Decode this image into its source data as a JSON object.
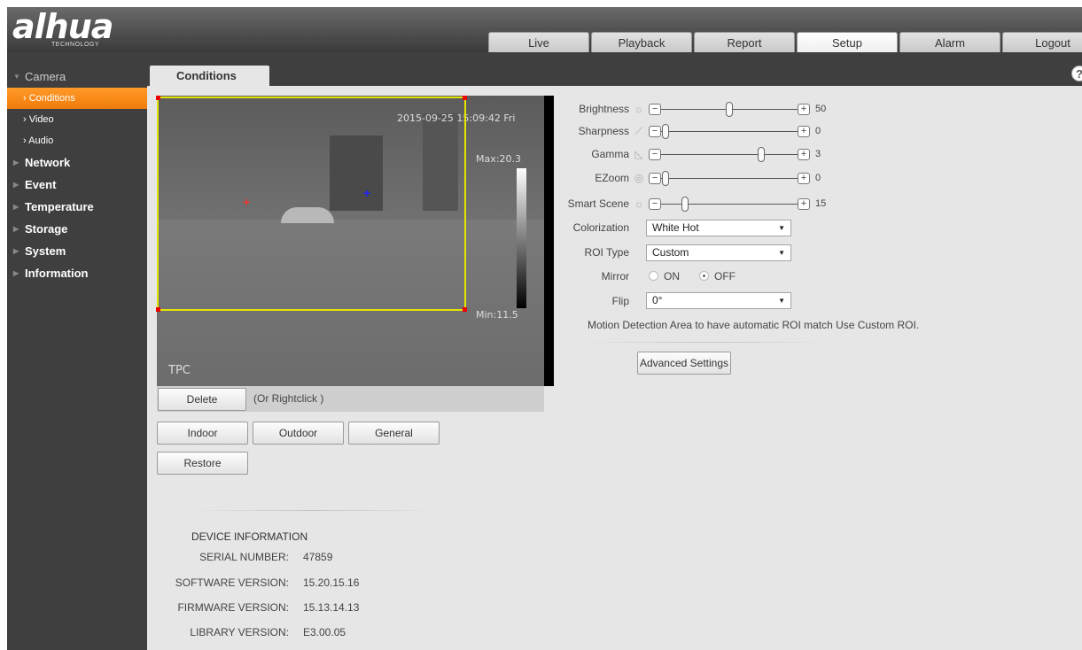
{
  "header": {
    "logo": "alhua",
    "logo_sub": "TECHNOLOGY",
    "tabs": [
      "Live",
      "Playback",
      "Report",
      "Setup",
      "Alarm",
      "Logout"
    ],
    "active_tab": "Setup"
  },
  "sidebar": {
    "camera": "Camera",
    "camera_items": [
      "Conditions",
      "Video",
      "Audio"
    ],
    "active_item": "Conditions",
    "sections": [
      "Network",
      "Event",
      "Temperature",
      "Storage",
      "System",
      "Information"
    ]
  },
  "page": {
    "tab": "Conditions",
    "help": "?"
  },
  "video": {
    "timestamp": "2015-09-25 15:09:42 Fri",
    "max_label": "Max:20.3",
    "min_label": "Min:11.5",
    "channel_label": "TPC"
  },
  "buttons": {
    "delete": "Delete",
    "delete_note": "(Or Rightclick )",
    "indoor": "Indoor",
    "outdoor": "Outdoor",
    "general": "General",
    "restore": "Restore",
    "advanced": "Advanced Settings"
  },
  "settings": {
    "brightness": {
      "label": "Brightness",
      "value": "50",
      "fraction": 0.5
    },
    "sharpness": {
      "label": "Sharpness",
      "value": "0",
      "fraction": 0.0
    },
    "gamma": {
      "label": "Gamma",
      "value": "3",
      "fraction": 0.75
    },
    "ezoom": {
      "label": "EZoom",
      "value": "0",
      "fraction": 0.0
    },
    "smart_scene": {
      "label": "Smart Scene",
      "value": "15",
      "fraction": 0.15
    },
    "colorization": {
      "label": "Colorization",
      "value": "White Hot"
    },
    "roi_type": {
      "label": "ROI Type",
      "value": "Custom"
    },
    "mirror": {
      "label": "Mirror",
      "on": "ON",
      "off": "OFF",
      "selected": "OFF"
    },
    "flip": {
      "label": "Flip",
      "value": "0°"
    },
    "motion_note": "Motion Detection Area to have automatic ROI match Use Custom ROI."
  },
  "device_info": {
    "title": "DEVICE INFORMATION",
    "rows": [
      {
        "key": "SERIAL NUMBER:",
        "value": "47859"
      },
      {
        "key": "SOFTWARE VERSION:",
        "value": "15.20.15.16"
      },
      {
        "key": "FIRMWARE VERSION:",
        "value": "15.13.14.13"
      },
      {
        "key": "LIBRARY VERSION:",
        "value": "E3.00.05"
      }
    ]
  },
  "icons": {
    "brightness": "sun-icon",
    "sharpness": "sharpness-icon",
    "gamma": "gamma-icon",
    "ezoom": "zoom-icon",
    "smart_scene": "scene-icon"
  },
  "colors": {
    "accent_orange": "#f08010",
    "roi_yellow": "#e4e400",
    "sidebar_bg": "#3f3f3f"
  }
}
